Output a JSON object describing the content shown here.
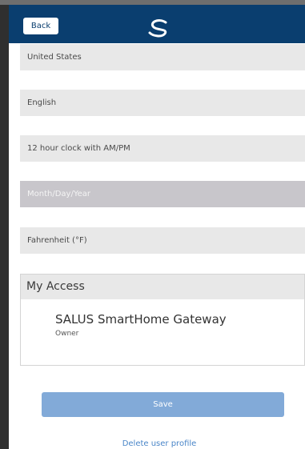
{
  "header": {
    "back_label": "Back",
    "logo_icon": "salus-s-logo-icon"
  },
  "fields": {
    "country": "United States",
    "language": "English",
    "time_format": "12 hour clock with AM/PM",
    "date_format": "Month/Day/Year",
    "temperature_unit": "Fahrenheit (°F)"
  },
  "access": {
    "title": "My Access",
    "device_name": "SALUS SmartHome Gateway",
    "device_role": "Owner"
  },
  "actions": {
    "save_label": "Save",
    "delete_label": "Delete user profile"
  },
  "colors": {
    "header": "#0a3e6f",
    "save_button": "#82aad8",
    "link": "#4a86c8"
  }
}
